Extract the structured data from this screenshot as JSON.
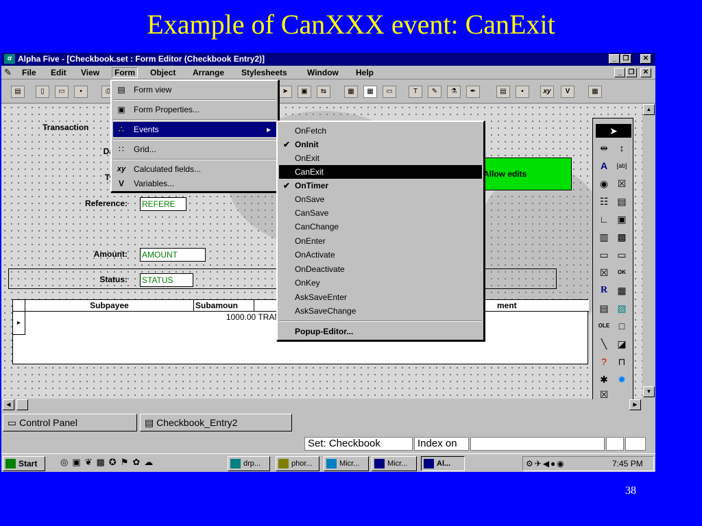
{
  "slide": {
    "title": "Example of CanXXX event: CanExit",
    "page_number": "38"
  },
  "window": {
    "title": "Alpha Five - [Checkbook.set : Form Editor (Checkbook Entry2)]",
    "app_icon": "α"
  },
  "menubar": {
    "items": [
      "File",
      "Edit",
      "View",
      "Form",
      "Object",
      "Arrange",
      "Stylesheets",
      "Window",
      "Help"
    ]
  },
  "form": {
    "allow_edits": "Allow edits",
    "labels": {
      "transaction": "Transaction",
      "date": "Da",
      "type": "Ty",
      "reference": "Reference:",
      "amount": "Amount:",
      "status": "Status:"
    },
    "values": {
      "reference": "REFERE",
      "amount": "AMOUNT",
      "status": "STATUS"
    },
    "grid": {
      "headers": [
        "Subpayee",
        "Subamoun",
        "ment"
      ],
      "row_amount": "1000.00 TRANS",
      "row_marker": "▸"
    }
  },
  "form_menu": {
    "items": [
      {
        "label": "Form view",
        "icon": "▤"
      },
      {
        "label": "Form Properties...",
        "icon": "▣"
      },
      {
        "label": "Events",
        "icon": "∴",
        "arrow": "▸"
      },
      {
        "label": "Grid...",
        "icon": "∷"
      },
      {
        "label": "Calculated fields...",
        "icon": "xy"
      },
      {
        "label": "Variables...",
        "icon": "V"
      }
    ]
  },
  "events_submenu": {
    "items": [
      {
        "label": "OnFetch",
        "checked": false
      },
      {
        "label": "OnInit",
        "checked": true
      },
      {
        "label": "OnExit",
        "checked": false
      },
      {
        "label": "CanExit",
        "checked": false
      },
      {
        "label": "OnTimer",
        "checked": true
      },
      {
        "label": "OnSave",
        "checked": false
      },
      {
        "label": "CanSave",
        "checked": false
      },
      {
        "label": "CanChange",
        "checked": false
      },
      {
        "label": "OnEnter",
        "checked": false
      },
      {
        "label": "OnActivate",
        "checked": false
      },
      {
        "label": "OnDeactivate",
        "checked": false
      },
      {
        "label": "OnKey",
        "checked": false
      },
      {
        "label": "AskSaveEnter",
        "checked": false
      },
      {
        "label": "AskSaveChange",
        "checked": false
      }
    ],
    "popup_editor": "Popup-Editor...",
    "selected": "CanExit",
    "check_mark": "✔"
  },
  "tabs": {
    "control_panel": "Control Panel",
    "checkbook_entry": "Checkbook_Entry2"
  },
  "statusbar": {
    "set": "Set: Checkbook",
    "index": "Index on"
  },
  "taskbar": {
    "start": "Start",
    "tasks": [
      "drp...",
      "phor...",
      "Micr...",
      "Micr...",
      "Al..."
    ],
    "clock": "7:45 PM"
  },
  "colors": {
    "slide_bg": "#0000ff",
    "title": "#ffff00",
    "titlebar": "#000080",
    "allow_edits": "#00e000",
    "field_text": "#008000"
  }
}
